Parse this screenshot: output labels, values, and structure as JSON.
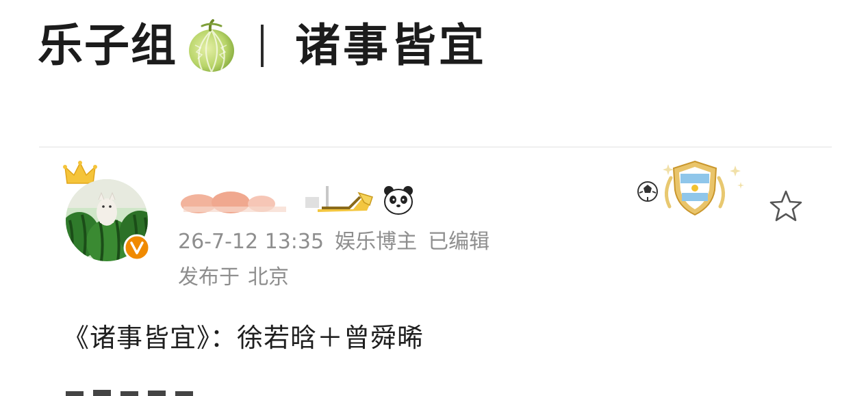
{
  "header": {
    "group_name": "乐子组",
    "group_icon": "melon-icon",
    "separator": "|",
    "title": "诸事皆宜"
  },
  "post": {
    "author": {
      "avatar": "watermelon-cat-avatar",
      "crown_icon": "crown-icon",
      "verified_icon": "orange-v-icon",
      "level_badge_icon": "level-badge-icon",
      "emoji_icon": "panda-icon"
    },
    "timestamp": "26-7-12 13:35",
    "author_type": "娱乐博主",
    "edited": "已编辑",
    "location_prefix": "发布于",
    "location": "北京",
    "fan_badge_icon": "argentina-shield-badge-icon",
    "favorite_icon": "star-icon",
    "content": "《诸事皆宜》：徐若晗＋曾舜晞"
  },
  "colors": {
    "text_primary": "#1c1c1c",
    "text_meta": "#8e8e8e",
    "divider": "#efefef",
    "verified_orange": "#f08a00"
  }
}
